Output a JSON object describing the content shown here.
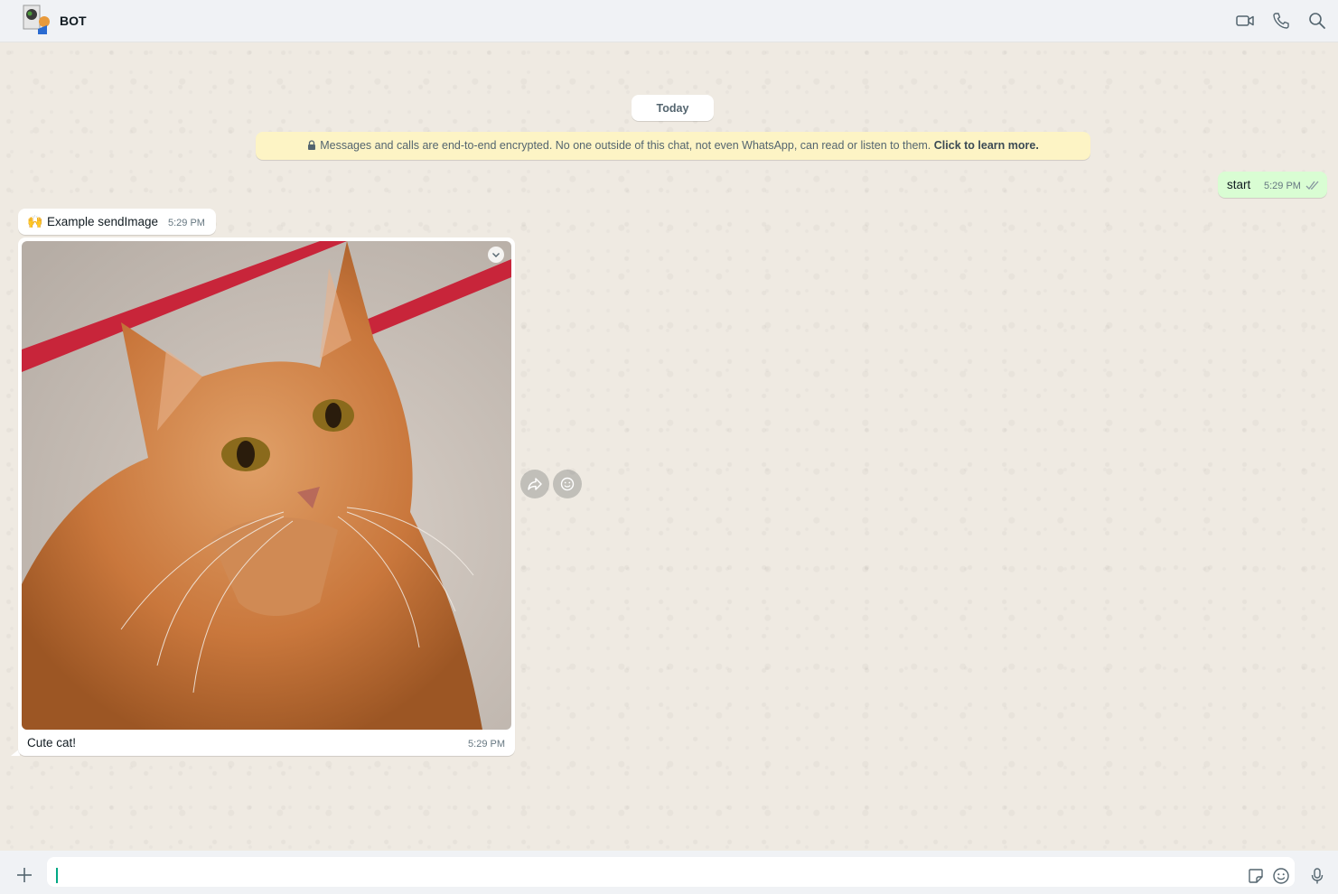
{
  "header": {
    "contact_name": "BOT",
    "icons": [
      "video-call-icon",
      "voice-call-icon",
      "search-icon"
    ]
  },
  "chat": {
    "date_label": "Today",
    "encryption_notice": {
      "text": "Messages and calls are end-to-end encrypted. No one outside of this chat, not even WhatsApp, can read or listen to them.",
      "link": "Click to learn more."
    },
    "messages": [
      {
        "direction": "out",
        "text": "start",
        "time": "5:29 PM",
        "status": "read"
      },
      {
        "direction": "in",
        "emoji": "🙌",
        "text": "Example sendImage",
        "time": "5:29 PM"
      },
      {
        "direction": "in",
        "type": "image",
        "caption": "Cute cat!",
        "time": "5:29 PM",
        "image": "orange-tabby-cat-photo"
      }
    ]
  },
  "footer": {
    "input_value": "",
    "icons": [
      "plus-icon",
      "sticker-icon",
      "emoji-icon",
      "microphone-icon"
    ]
  },
  "colors": {
    "outgoing_bubble": "#d9fdd3",
    "incoming_bubble": "#ffffff",
    "chat_background": "#efeae2",
    "encryption_banner": "#fdf4c5",
    "accent": "#00a884"
  }
}
